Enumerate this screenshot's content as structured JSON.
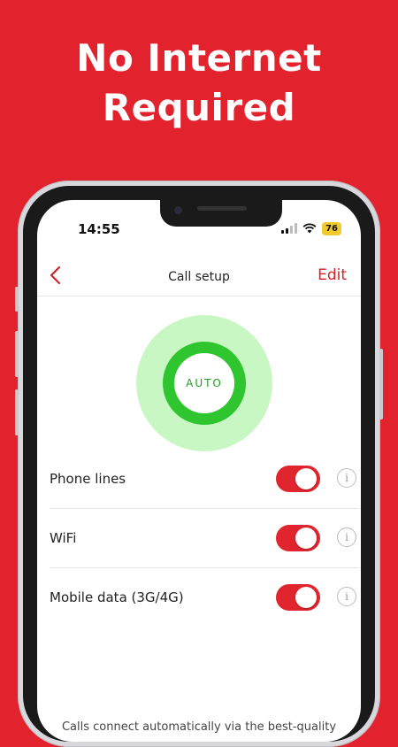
{
  "headline": {
    "line1": "No Internet",
    "line2": "Required"
  },
  "status_bar": {
    "time": "14:55",
    "battery": "76"
  },
  "nav": {
    "title": "Call setup",
    "edit_label": "Edit"
  },
  "dial": {
    "label": "AUTO"
  },
  "rows": [
    {
      "label": "Phone lines",
      "enabled": true,
      "info_icon": "i"
    },
    {
      "label": "WiFi",
      "enabled": true,
      "info_icon": "i"
    },
    {
      "label": "Mobile data (3G/4G)",
      "enabled": true,
      "info_icon": "i"
    }
  ],
  "footnote": "Calls connect automatically via the best-quality",
  "colors": {
    "brand_red": "#e2232e",
    "accent_green": "#2ec52e",
    "light_green": "#c9f7c3",
    "battery_yellow": "#f0c92d"
  }
}
